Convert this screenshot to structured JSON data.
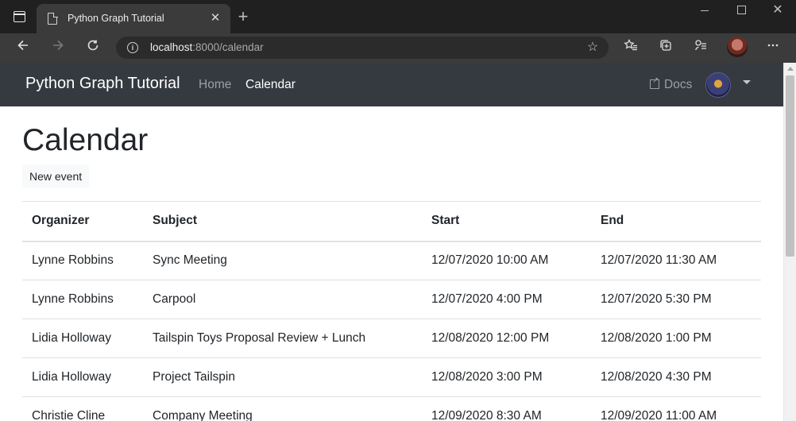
{
  "browser": {
    "tab_title": "Python Graph Tutorial",
    "close_glyph": "✕",
    "new_tab_glyph": "+",
    "url_host": "localhost",
    "url_path": ":8000/calendar"
  },
  "navbar": {
    "brand": "Python Graph Tutorial",
    "home": "Home",
    "calendar": "Calendar",
    "docs": "Docs"
  },
  "page": {
    "title": "Calendar",
    "new_event": "New event"
  },
  "table": {
    "headers": [
      "Organizer",
      "Subject",
      "Start",
      "End"
    ],
    "rows": [
      [
        "Lynne Robbins",
        "Sync Meeting",
        "12/07/2020 10:00 AM",
        "12/07/2020 11:30 AM"
      ],
      [
        "Lynne Robbins",
        "Carpool",
        "12/07/2020 4:00 PM",
        "12/07/2020 5:30 PM"
      ],
      [
        "Lidia Holloway",
        "Tailspin Toys Proposal Review + Lunch",
        "12/08/2020 12:00 PM",
        "12/08/2020 1:00 PM"
      ],
      [
        "Lidia Holloway",
        "Project Tailspin",
        "12/08/2020 3:00 PM",
        "12/08/2020 4:30 PM"
      ],
      [
        "Christie Cline",
        "Company Meeting",
        "12/09/2020 8:30 AM",
        "12/09/2020 11:00 AM"
      ]
    ]
  },
  "colors": {
    "navbar_bg": "#343a40",
    "chrome_bg": "#202020",
    "toolbar_bg": "#3b3b3b",
    "table_border": "#dee2e6"
  },
  "icons": {
    "window": "window-icon",
    "page": "page-icon",
    "back": "back-arrow-icon",
    "forward": "forward-arrow-icon",
    "refresh": "refresh-icon",
    "info": "info-icon",
    "add_favorite": "add-favorite-icon",
    "favorites": "favorites-icon",
    "collections": "collections-icon",
    "extensions": "extensions-icon",
    "menu": "more-icon",
    "external": "external-link-icon"
  }
}
